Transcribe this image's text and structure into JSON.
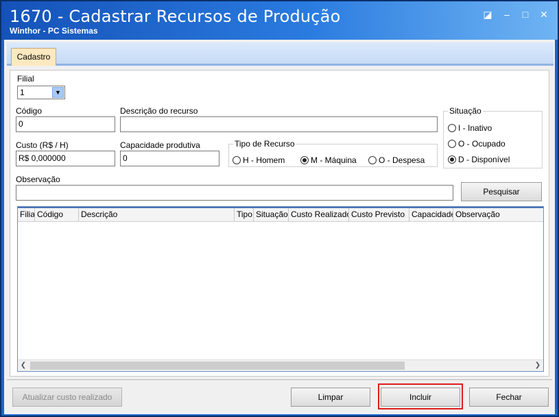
{
  "window": {
    "title": "1670 - Cadastrar Recursos de Produção",
    "subtitle": "Winthor - PC Sistemas"
  },
  "tabs": [
    {
      "label": "Cadastro"
    }
  ],
  "form": {
    "filial": {
      "label": "Filial",
      "value": "1"
    },
    "codigo": {
      "label": "Código",
      "value": "0"
    },
    "descricao": {
      "label": "Descrição do recurso",
      "value": ""
    },
    "custo": {
      "label": "Custo (R$ / H)",
      "value": "R$ 0,000000"
    },
    "capacidade": {
      "label": "Capacidade produtiva",
      "value": "0"
    },
    "tipo_recurso": {
      "label": "Tipo de Recurso",
      "options": [
        {
          "label": "H - Homem",
          "selected": false
        },
        {
          "label": "M - Máquina",
          "selected": true
        },
        {
          "label": "O - Despesa",
          "selected": false
        }
      ]
    },
    "situacao": {
      "label": "Situação",
      "options": [
        {
          "label": "I - Inativo",
          "selected": false
        },
        {
          "label": "O - Ocupado",
          "selected": false
        },
        {
          "label": "D - Disponível",
          "selected": true
        }
      ]
    },
    "observacao": {
      "label": "Observação",
      "value": ""
    },
    "pesquisar_label": "Pesquisar"
  },
  "grid": {
    "columns": [
      "Filial",
      "Código",
      "Descrição",
      "Tipo",
      "Situação",
      "Custo Realizado",
      "Custo Previsto",
      "Capacidade",
      "Observação"
    ],
    "rows": []
  },
  "footer": {
    "atualizar_label": "Atualizar custo realizado",
    "limpar_label": "Limpar",
    "incluir_label": "Incluir",
    "fechar_label": "Fechar"
  }
}
